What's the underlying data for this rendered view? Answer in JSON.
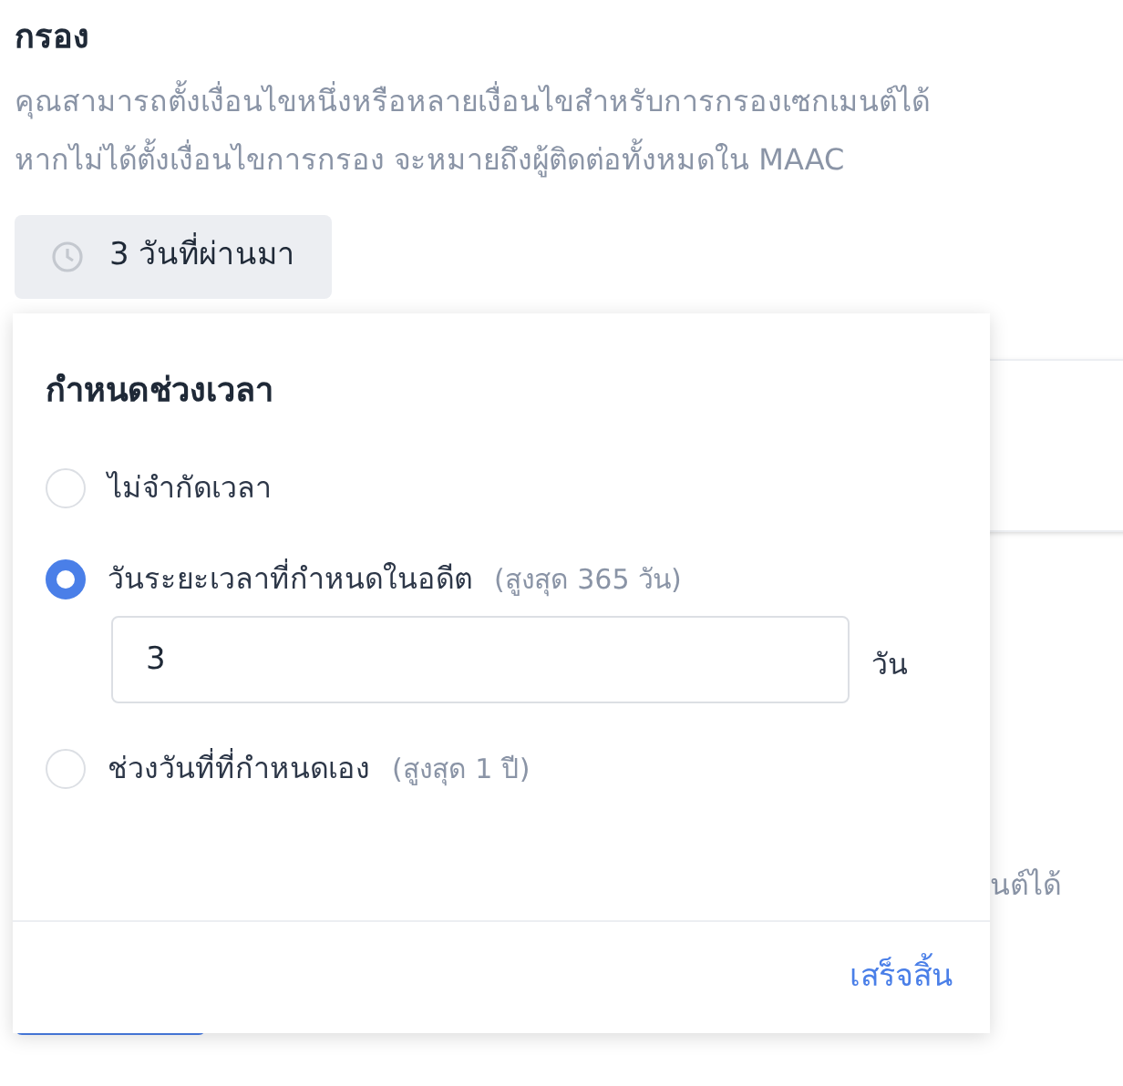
{
  "section": {
    "title": "กรอง",
    "description": [
      "คุณสามารถตั้งเงื่อนไขหนึ่งหรือหลายเงื่อนไขสำหรับการกรองเซกเมนต์ได้",
      "หากไม่ได้ตั้งเงื่อนไขการกรอง จะหมายถึงผู้ติดต่อทั้งหมดใน MAAC"
    ],
    "date_button": {
      "label": "3 วันที่ผ่านมา"
    },
    "hidden_text": "นต์ได้"
  },
  "popover": {
    "title": "กำหนดช่วงเวลา",
    "options": [
      {
        "label": "ไม่จำกัดเวลา",
        "selected": false
      },
      {
        "label": "วันระยะเวลาที่กำหนดในอดีต",
        "hint": "(สูงสุด 365 วัน)",
        "selected": true,
        "input": {
          "value": "3",
          "unit": "วัน"
        }
      },
      {
        "label": "ช่วงวันที่ที่กำหนดเอง",
        "hint": "(สูงสุด 1 ปี)",
        "selected": false
      }
    ],
    "done": "เสร็จสิ้น"
  }
}
